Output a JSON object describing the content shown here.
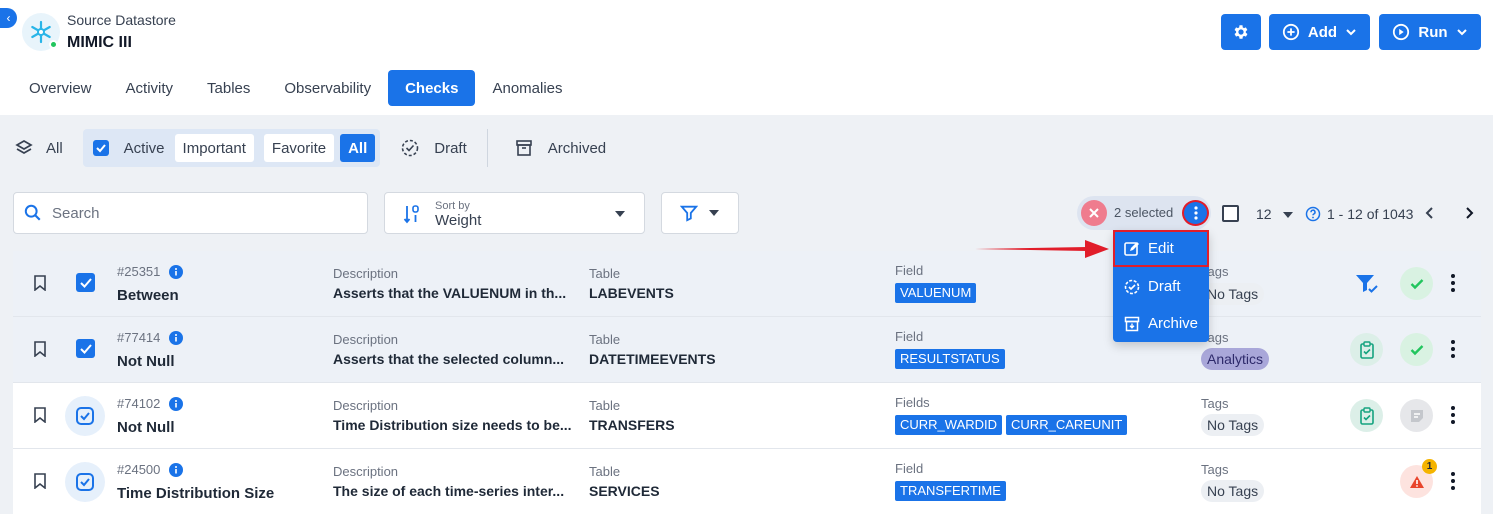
{
  "header": {
    "subtitle": "Source Datastore",
    "name": "MIMIC III",
    "add_label": "Add",
    "run_label": "Run"
  },
  "tabs": [
    {
      "label": "Overview"
    },
    {
      "label": "Activity"
    },
    {
      "label": "Tables"
    },
    {
      "label": "Observability"
    },
    {
      "label": "Checks",
      "active": true
    },
    {
      "label": "Anomalies"
    }
  ],
  "filters": {
    "all": "All",
    "active": "Active",
    "important": "Important",
    "favorite": "Favorite",
    "all_chip": "All",
    "draft": "Draft",
    "archived": "Archived"
  },
  "search": {
    "placeholder": "Search"
  },
  "sort": {
    "label": "Sort by",
    "value": "Weight"
  },
  "selection": {
    "text": "2 selected"
  },
  "pagination": {
    "page_size": "12",
    "info": "1 - 12 of 1043"
  },
  "row_labels": {
    "description": "Description",
    "table": "Table",
    "field": "Field",
    "fields": "Fields",
    "tags": "Tags"
  },
  "checks": [
    {
      "id": "#25351",
      "name": "Between",
      "description": "Asserts that the VALUENUM in th...",
      "table": "LABEVENTS",
      "field_label": "Field",
      "fields": [
        "VALUENUM"
      ],
      "tags": [
        "No Tags"
      ],
      "selected": true
    },
    {
      "id": "#77414",
      "name": "Not Null",
      "description": "Asserts that the selected column...",
      "table": "DATETIMEEVENTS",
      "field_label": "Field",
      "fields": [
        "RESULTSTATUS"
      ],
      "tags": [
        "Analytics"
      ],
      "selected": true
    },
    {
      "id": "#74102",
      "name": "Not Null",
      "description": "Time Distribution size needs to be...",
      "table": "TRANSFERS",
      "field_label": "Fields",
      "fields": [
        "CURR_WARDID",
        "CURR_CAREUNIT"
      ],
      "tags": [
        "No Tags"
      ],
      "selected": false
    },
    {
      "id": "#24500",
      "name": "Time Distribution Size",
      "description": "The size of each time-series inter...",
      "table": "SERVICES",
      "field_label": "Field",
      "fields": [
        "TRANSFERTIME"
      ],
      "tags": [
        "No Tags"
      ],
      "selected": false,
      "anomaly_count": "1"
    }
  ],
  "bulk_menu": {
    "edit": "Edit",
    "draft": "Draft",
    "archive": "Archive"
  },
  "colors": {
    "accent": "#1a73e8",
    "highlight": "#e11d2a",
    "success": "#22c55e"
  }
}
